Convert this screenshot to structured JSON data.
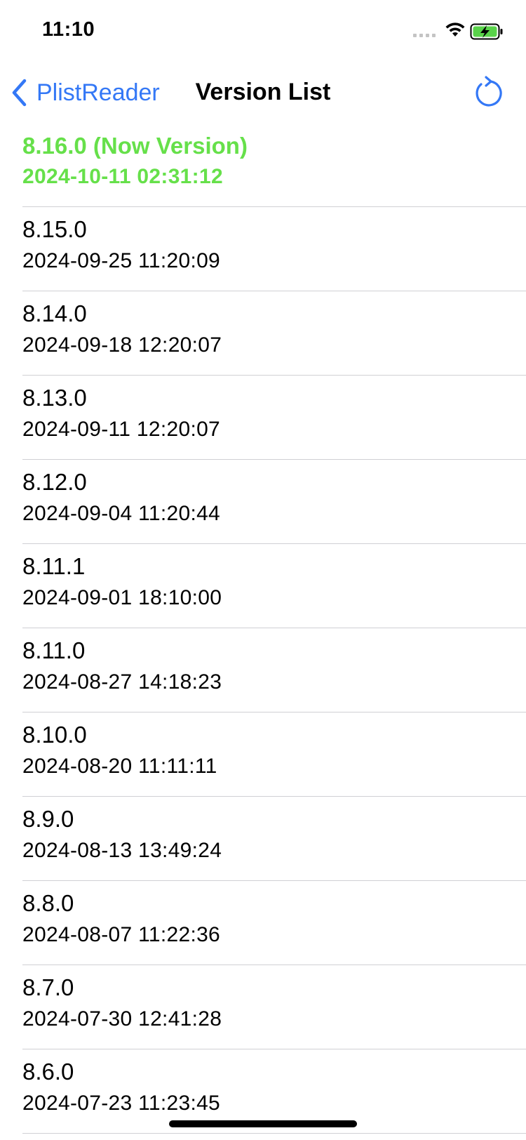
{
  "status_bar": {
    "time": "11:10"
  },
  "nav": {
    "back_label": "PlistReader",
    "title": "Version List",
    "refresh_icon": "refresh-icon"
  },
  "colors": {
    "accent": "#3478f6",
    "current_version": "#66e04a"
  },
  "versions": [
    {
      "version": "8.16.0 (Now Version)",
      "date": "2024-10-11 02:31:12",
      "current": true
    },
    {
      "version": "8.15.0",
      "date": "2024-09-25 11:20:09"
    },
    {
      "version": "8.14.0",
      "date": "2024-09-18 12:20:07"
    },
    {
      "version": "8.13.0",
      "date": "2024-09-11 12:20:07"
    },
    {
      "version": "8.12.0",
      "date": "2024-09-04 11:20:44"
    },
    {
      "version": "8.11.1",
      "date": "2024-09-01 18:10:00"
    },
    {
      "version": "8.11.0",
      "date": "2024-08-27 14:18:23"
    },
    {
      "version": "8.10.0",
      "date": "2024-08-20 11:11:11"
    },
    {
      "version": "8.9.0",
      "date": "2024-08-13 13:49:24"
    },
    {
      "version": "8.8.0",
      "date": "2024-08-07 11:22:36"
    },
    {
      "version": "8.7.0",
      "date": "2024-07-30 12:41:28"
    },
    {
      "version": "8.6.0",
      "date": "2024-07-23 11:23:45"
    }
  ]
}
